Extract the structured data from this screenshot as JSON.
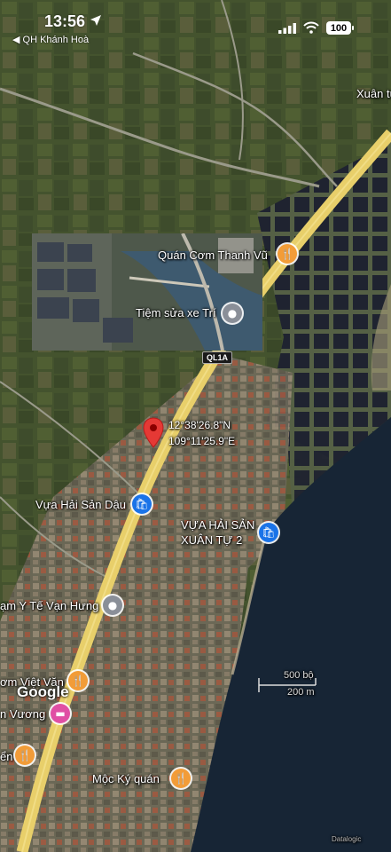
{
  "status_bar": {
    "time": "13:56",
    "back_label": "◀ QH Khánh Hoà",
    "battery": "100"
  },
  "map": {
    "dropped_pin": {
      "lat": "12°38'26.8\"N",
      "lng": "109°11'25.9\"E"
    },
    "road_shield": "QL1A",
    "places": [
      {
        "name": "Xuân tự",
        "type": "area"
      },
      {
        "name": "Quán Cơm Thanh Vũ",
        "type": "restaurant"
      },
      {
        "name": "Tiệm sửa xe Trí",
        "type": "service"
      },
      {
        "name": "Vựa Hải Sản Dậu",
        "type": "shopping"
      },
      {
        "name": "VỰA HẢI SẢN",
        "type": "shopping"
      },
      {
        "name": "XUÂN TỰ 2",
        "type": "shopping"
      },
      {
        "name": "ạm Y Tế Vạn Hưng",
        "type": "service"
      },
      {
        "name": "ơm Việt Văn",
        "type": "restaurant"
      },
      {
        "name": "n Vương",
        "type": "hotel"
      },
      {
        "name": "ển",
        "type": "restaurant"
      },
      {
        "name": "Mộc Ký quán",
        "type": "restaurant"
      }
    ],
    "scale": {
      "top": "500 bộ",
      "bottom": "200 m"
    },
    "attribution": "Google",
    "imagery_credit": "Datalogic"
  },
  "colors": {
    "restaurant_pin": "#f29c38",
    "shopping_pin": "#1a73e8",
    "service_pin": "#8a8f98",
    "hotel_pin": "#e04fa4",
    "dropped_pin": "#e53935",
    "road": "#e8cf6a"
  }
}
